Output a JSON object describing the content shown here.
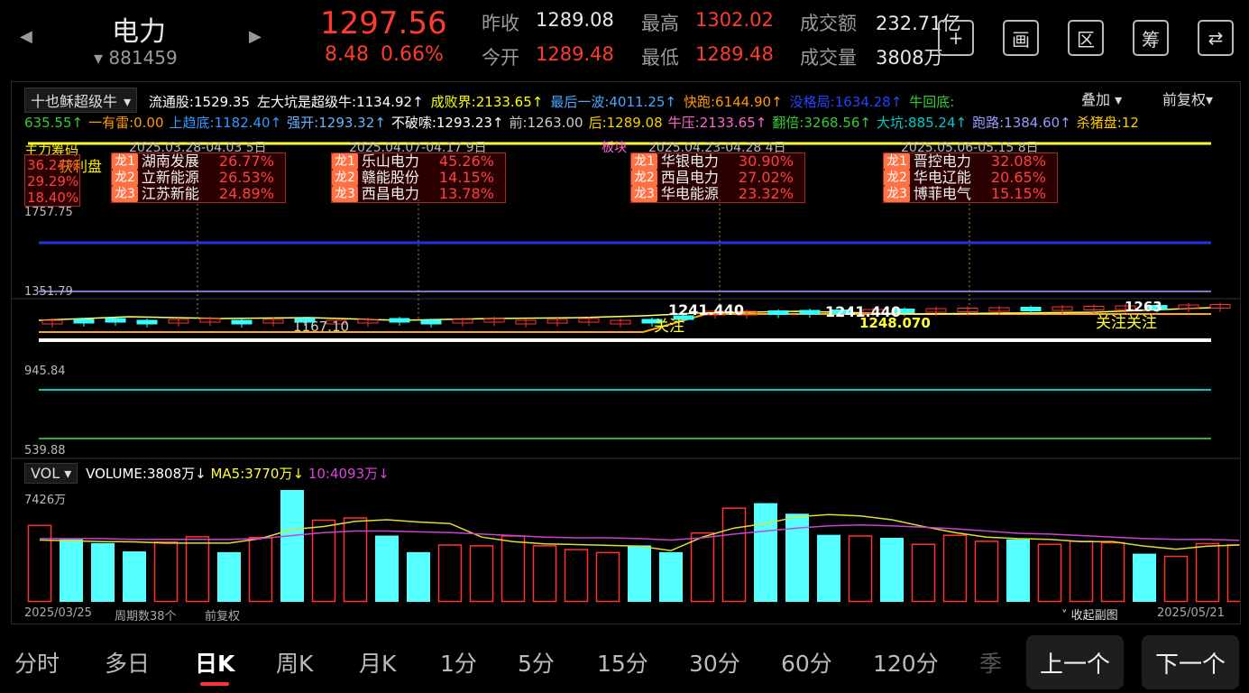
{
  "header": {
    "name": "电力",
    "code": "881459",
    "price": "1297.56",
    "change": "8.48",
    "change_pct": "0.66%",
    "stats": [
      {
        "label": "昨收",
        "value": "1289.08",
        "color": "#e8e8e8"
      },
      {
        "label": "今开",
        "value": "1289.48",
        "color": "#ff3b30"
      },
      {
        "label": "最高",
        "value": "1302.02",
        "color": "#ff3b30"
      },
      {
        "label": "最低",
        "value": "1289.48",
        "color": "#ff3b30"
      },
      {
        "label": "成交额",
        "value": "232.71亿",
        "color": "#e8e8e8"
      },
      {
        "label": "成交量",
        "value": "3808万",
        "color": "#e8e8e8"
      }
    ],
    "tools": [
      {
        "icon": "plus-icon",
        "text": "+"
      },
      {
        "icon": "draw-icon",
        "text": "画"
      },
      {
        "icon": "range-icon",
        "text": "区"
      },
      {
        "icon": "chips-icon",
        "text": "筹"
      },
      {
        "icon": "phone-switch-icon",
        "text": "⇄"
      }
    ]
  },
  "indicator": {
    "selector": "十也稣超级牛",
    "overlay": "叠加",
    "adjust": "前复权",
    "row1": [
      {
        "text": "流通股:1529.35",
        "color": "#ffffff"
      },
      {
        "text": "左大坑是超级牛:1134.92↑",
        "color": "#ffffff"
      },
      {
        "text": "成败界:2133.65↑",
        "color": "#ffff00"
      },
      {
        "text": "最后一波:4011.25↑",
        "color": "#4da6ff"
      },
      {
        "text": "快跑:6144.90↑",
        "color": "#ff9900"
      },
      {
        "text": "没格局:1634.28↑",
        "color": "#2244ff"
      },
      {
        "text": "牛回底:",
        "color": "#33cc33"
      }
    ],
    "row2": [
      {
        "text": "635.55↑",
        "color": "#33cc33"
      },
      {
        "text": "一有雷:0.00",
        "color": "#ff9900"
      },
      {
        "text": "上趋底:1182.40↑",
        "color": "#3399ff"
      },
      {
        "text": "强开:1293.32↑",
        "color": "#66b3ff"
      },
      {
        "text": "不破嗦:1293.23↑",
        "color": "#ffffff"
      },
      {
        "text": "前:1263.00",
        "color": "#cccccc"
      },
      {
        "text": "后:1289.08",
        "color": "#ffcc00"
      },
      {
        "text": "牛压:2133.65↑",
        "color": "#ff66cc"
      },
      {
        "text": "翻倍:3268.56↑",
        "color": "#33cc33"
      },
      {
        "text": "大坑:885.24↑",
        "color": "#00cccc"
      },
      {
        "text": "跑路:1384.60↑",
        "color": "#9999ff"
      },
      {
        "text": "杀猪盘:12",
        "color": "#ffcc00"
      }
    ]
  },
  "annotations": [
    {
      "head": "2025.03.28-04.03   5日",
      "items": [
        {
          "rank": "龙1",
          "name": "湖南发展",
          "pct": "26.77%"
        },
        {
          "rank": "龙2",
          "name": "立新能源",
          "pct": "26.53%"
        },
        {
          "rank": "龙3",
          "name": "江苏新能",
          "pct": "24.89%"
        }
      ]
    },
    {
      "head": "2025.04.07-04.17   9日",
      "items": [
        {
          "rank": "龙1",
          "name": "乐山电力",
          "pct": "45.26%"
        },
        {
          "rank": "龙2",
          "name": "赣能股份",
          "pct": "14.15%"
        },
        {
          "rank": "龙3",
          "name": "西昌电力",
          "pct": "13.78%"
        }
      ]
    },
    {
      "head": "2025.04.23-04.28   4日",
      "items": [
        {
          "rank": "龙1",
          "name": "华银电力",
          "pct": "30.90%"
        },
        {
          "rank": "龙2",
          "name": "西昌电力",
          "pct": "27.02%"
        },
        {
          "rank": "龙3",
          "name": "华电能源",
          "pct": "23.32%"
        }
      ]
    },
    {
      "head": "2025.05.06-05.15   8日",
      "items": [
        {
          "rank": "龙1",
          "name": "晋控电力",
          "pct": "32.08%"
        },
        {
          "rank": "龙2",
          "name": "华电辽能",
          "pct": "20.65%"
        },
        {
          "rank": "龙3",
          "name": "博菲电气",
          "pct": "15.15%"
        }
      ]
    }
  ],
  "left_box": {
    "title": "主力筹码",
    "profit": "获利盘",
    "values": [
      "36.24%",
      "29.29%",
      "18.40%"
    ]
  },
  "board_label": "板块",
  "price_axis": [
    "1757.75",
    "1351.79",
    "945.84",
    "539.88"
  ],
  "price_marks": {
    "high1": "1241.440",
    "high2": "1241.440",
    "low": "1167.10",
    "mid": "1248.070",
    "right": "1263",
    "focus": "关注",
    "focus2": "关注关注"
  },
  "volume": {
    "selector": "VOL",
    "label": "VOLUME:3808万↓",
    "ma5": "MA5:3770万↓",
    "ma10": "10:4093万↓",
    "max": "7426万",
    "bars": [
      {
        "v": 5100,
        "up": true
      },
      {
        "v": 4150,
        "up": false
      },
      {
        "v": 3900,
        "up": false
      },
      {
        "v": 3350,
        "up": false
      },
      {
        "v": 4000,
        "up": true
      },
      {
        "v": 4350,
        "up": true
      },
      {
        "v": 3300,
        "up": false
      },
      {
        "v": 4300,
        "up": true
      },
      {
        "v": 7426,
        "up": false
      },
      {
        "v": 5450,
        "up": true
      },
      {
        "v": 5600,
        "up": true
      },
      {
        "v": 4400,
        "up": false
      },
      {
        "v": 3300,
        "up": false
      },
      {
        "v": 3800,
        "up": true
      },
      {
        "v": 3750,
        "up": true
      },
      {
        "v": 4400,
        "up": true
      },
      {
        "v": 3750,
        "up": true
      },
      {
        "v": 3500,
        "up": true
      },
      {
        "v": 3300,
        "up": true
      },
      {
        "v": 3750,
        "up": false
      },
      {
        "v": 3300,
        "up": false
      },
      {
        "v": 4600,
        "up": true
      },
      {
        "v": 6250,
        "up": true
      },
      {
        "v": 6550,
        "up": false
      },
      {
        "v": 5850,
        "up": false
      },
      {
        "v": 4450,
        "up": false
      },
      {
        "v": 4400,
        "up": true
      },
      {
        "v": 4250,
        "up": false
      },
      {
        "v": 3850,
        "up": true
      },
      {
        "v": 4450,
        "up": true
      },
      {
        "v": 4050,
        "up": true
      },
      {
        "v": 4150,
        "up": false
      },
      {
        "v": 3850,
        "up": true
      },
      {
        "v": 4050,
        "up": true
      },
      {
        "v": 3950,
        "up": true
      },
      {
        "v": 3200,
        "up": false
      },
      {
        "v": 3050,
        "up": true
      },
      {
        "v": 3900,
        "up": true
      },
      {
        "v": 3808,
        "up": true
      }
    ],
    "ma5_line": [
      4100,
      4050,
      4000,
      3980,
      3900,
      3900,
      3900,
      4200,
      4800,
      5000,
      5350,
      5450,
      5300,
      5200,
      4300,
      4000,
      3850,
      3800,
      3750,
      3700,
      3400,
      4300,
      4900,
      5200,
      5650,
      5800,
      5700,
      5450,
      5000,
      4600,
      4300,
      4200,
      4150,
      4000,
      4000,
      3700,
      3500,
      3700,
      3770
    ],
    "ma10_line": [
      4200,
      4200,
      4200,
      4150,
      4150,
      4150,
      4150,
      4200,
      4400,
      4600,
      4700,
      4700,
      4650,
      4600,
      4500,
      4400,
      4300,
      4250,
      4250,
      4200,
      4100,
      4250,
      4500,
      4700,
      4900,
      5050,
      5100,
      5050,
      4950,
      4850,
      4700,
      4550,
      4500,
      4400,
      4300,
      4200,
      4150,
      4150,
      4093
    ]
  },
  "footer": {
    "start": "2025/03/25",
    "periods": "周期数38个",
    "adjust": "前复权",
    "collapse": "收起副图",
    "end": "2025/05/21"
  },
  "tabs": [
    "分时",
    "多日",
    "日K",
    "周K",
    "月K",
    "1分",
    "5分",
    "15分",
    "30分",
    "60分",
    "120分",
    "季"
  ],
  "active_tab": "日K",
  "nav": {
    "prev": "上一个",
    "next": "下一个"
  }
}
